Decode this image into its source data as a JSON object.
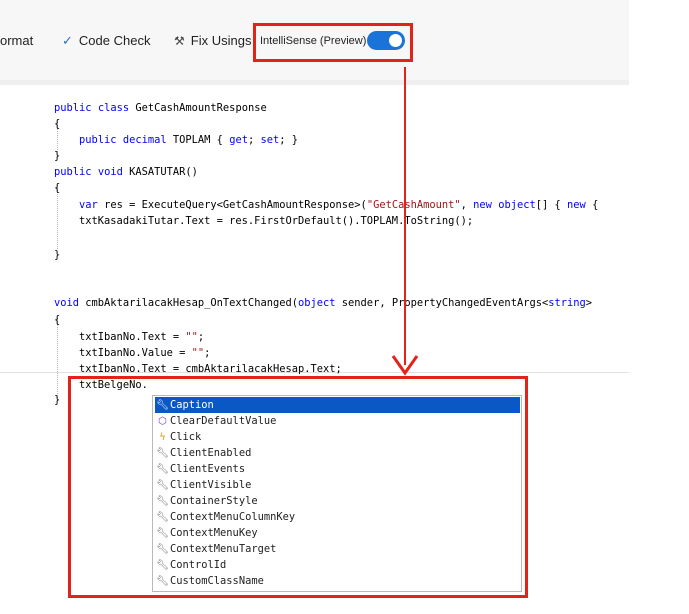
{
  "toolbar": {
    "format_label": "ormat",
    "code_check_label": "Code Check",
    "fix_usings_label": "Fix Usings",
    "intellisense_label": "IntelliSense (Preview)",
    "intellisense_enabled": true
  },
  "code": {
    "lines": [
      "public class GetCashAmountResponse",
      "{",
      "    public decimal TOPLAM { get; set; }",
      "}",
      "public void KASATUTAR()",
      "{",
      "    var res = ExecuteQuery<GetCashAmountResponse>(\"GetCashAmount\", new object[] { new {",
      "    txtKasadakiTutar.Text = res.FirstOrDefault().TOPLAM.ToString();",
      "",
      "}",
      "",
      "",
      "void cmbAktarilacakHesap_OnTextChanged(object sender, PropertyChangedEventArgs<string>",
      "{",
      "    txtIbanNo.Text = \"\";",
      "    txtIbanNo.Value = \"\";",
      "    txtIbanNo.Text = cmbAktarilacakHesap.Text;",
      "    txtBelgeNo.",
      "}"
    ]
  },
  "autocomplete": {
    "selected_index": 0,
    "items": [
      {
        "label": "Caption",
        "icon": "wrench-icon"
      },
      {
        "label": "ClearDefaultValue",
        "icon": "method-cube-icon"
      },
      {
        "label": "Click",
        "icon": "lightning-icon"
      },
      {
        "label": "ClientEnabled",
        "icon": "wrench-icon"
      },
      {
        "label": "ClientEvents",
        "icon": "wrench-icon"
      },
      {
        "label": "ClientVisible",
        "icon": "wrench-icon"
      },
      {
        "label": "ContainerStyle",
        "icon": "wrench-icon"
      },
      {
        "label": "ContextMenuColumnKey",
        "icon": "wrench-icon"
      },
      {
        "label": "ContextMenuKey",
        "icon": "wrench-icon"
      },
      {
        "label": "ContextMenuTarget",
        "icon": "wrench-icon"
      },
      {
        "label": "ControlId",
        "icon": "wrench-icon"
      },
      {
        "label": "CustomClassName",
        "icon": "wrench-icon"
      }
    ]
  },
  "colors": {
    "keyword": "#0000ff",
    "string": "#a31515",
    "selection": "#0a58c6",
    "annotation": "#e2231a",
    "toggle": "#1a73d9"
  }
}
